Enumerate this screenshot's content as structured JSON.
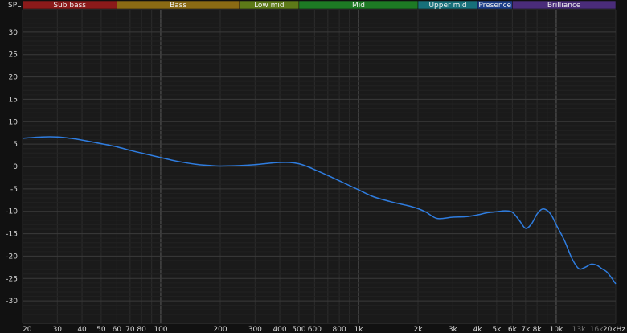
{
  "chart_data": {
    "type": "line",
    "ylabel": "SPL",
    "x_scale": "log",
    "xlim": [
      20,
      20000
    ],
    "ylim": [
      -35,
      35
    ],
    "grid": true,
    "y_ticks": [
      30,
      25,
      20,
      15,
      10,
      5,
      0,
      -5,
      -10,
      -15,
      -20,
      -25,
      -30
    ],
    "x_ticks": [
      {
        "value": 20,
        "label": "20"
      },
      {
        "value": 30,
        "label": "30"
      },
      {
        "value": 40,
        "label": "40"
      },
      {
        "value": 50,
        "label": "50"
      },
      {
        "value": 60,
        "label": "60"
      },
      {
        "value": 70,
        "label": "70"
      },
      {
        "value": 80,
        "label": "80"
      },
      {
        "value": 100,
        "label": "100"
      },
      {
        "value": 200,
        "label": "200"
      },
      {
        "value": 300,
        "label": "300"
      },
      {
        "value": 400,
        "label": "400"
      },
      {
        "value": 500,
        "label": "500"
      },
      {
        "value": 600,
        "label": "600"
      },
      {
        "value": 800,
        "label": "800"
      },
      {
        "value": 1000,
        "label": "1k"
      },
      {
        "value": 2000,
        "label": "2k"
      },
      {
        "value": 3000,
        "label": "3k"
      },
      {
        "value": 4000,
        "label": "4k"
      },
      {
        "value": 5000,
        "label": "5k"
      },
      {
        "value": 6000,
        "label": "6k"
      },
      {
        "value": 7000,
        "label": "7k"
      },
      {
        "value": 8000,
        "label": "8k"
      },
      {
        "value": 10000,
        "label": "10k"
      },
      {
        "value": 13000,
        "label": "13k",
        "dim": true
      },
      {
        "value": 16000,
        "label": "16k",
        "dim": true
      },
      {
        "value": 20000,
        "label": "20kHz"
      }
    ],
    "bands": [
      {
        "label": "Sub bass",
        "from": 20,
        "to": 60,
        "color": "#8b1a1a"
      },
      {
        "label": "Bass",
        "from": 60,
        "to": 250,
        "color": "#8a6a14"
      },
      {
        "label": "Low mid",
        "from": 250,
        "to": 500,
        "color": "#5d7a18"
      },
      {
        "label": "Mid",
        "from": 500,
        "to": 2000,
        "color": "#1d7a24"
      },
      {
        "label": "Upper mid",
        "from": 2000,
        "to": 4000,
        "color": "#17707a"
      },
      {
        "label": "Presence",
        "from": 4000,
        "to": 6000,
        "color": "#1d3f8a"
      },
      {
        "label": "Brilliance",
        "from": 6000,
        "to": 20000,
        "color": "#4a2c7a"
      }
    ],
    "series": [
      {
        "color": "#2f7de0",
        "x": [
          20,
          25,
          30,
          35,
          40,
          50,
          60,
          70,
          80,
          100,
          120,
          150,
          180,
          200,
          250,
          300,
          350,
          400,
          450,
          500,
          550,
          600,
          700,
          800,
          1000,
          1200,
          1500,
          1800,
          2000,
          2200,
          2500,
          3000,
          3500,
          4000,
          4500,
          5000,
          5500,
          6000,
          6500,
          7000,
          7500,
          8000,
          8500,
          9000,
          9500,
          10000,
          11000,
          12000,
          13000,
          14000,
          15000,
          16000,
          17000,
          18000,
          19000,
          20000
        ],
        "values": [
          6.3,
          6.6,
          6.6,
          6.3,
          5.9,
          5.1,
          4.4,
          3.6,
          3.0,
          2.0,
          1.2,
          0.5,
          0.2,
          0.1,
          0.2,
          0.4,
          0.7,
          0.9,
          0.9,
          0.6,
          0.0,
          -0.7,
          -2.0,
          -3.2,
          -5.2,
          -6.8,
          -8.0,
          -8.8,
          -9.4,
          -10.2,
          -11.6,
          -11.3,
          -11.2,
          -10.8,
          -10.3,
          -10.1,
          -9.9,
          -10.2,
          -12.0,
          -13.8,
          -12.8,
          -10.6,
          -9.5,
          -9.8,
          -11.0,
          -13.0,
          -16.5,
          -20.5,
          -22.8,
          -22.5,
          -21.8,
          -22.0,
          -22.8,
          -23.5,
          -24.8,
          -26.2
        ]
      }
    ]
  }
}
